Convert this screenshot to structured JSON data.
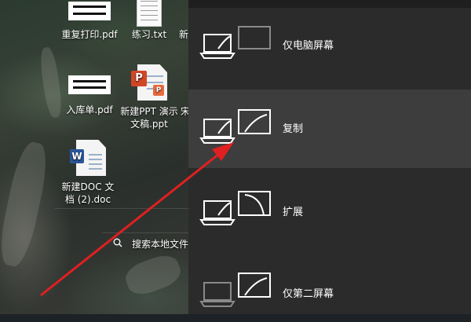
{
  "desktop": {
    "icons": [
      {
        "label": "重复打印.pdf",
        "kind": "pdf"
      },
      {
        "label": "练习.txt",
        "kind": "txt"
      },
      {
        "label": "入库单.pdf",
        "kind": "pdf"
      },
      {
        "label": "新建PPT 演示文稿.ppt",
        "kind": "ppt",
        "label_line1": "新建PPT 演示",
        "label_line2": "文稿.ppt"
      },
      {
        "label": "新建DOC 文档 (2).doc",
        "kind": "doc",
        "label_line1": "新建DOC 文",
        "label_line2": "档 (2).doc"
      }
    ],
    "partial_labels": [
      "新",
      "宋"
    ],
    "search": {
      "text": "搜索本地文件"
    }
  },
  "project_panel": {
    "options": [
      {
        "label": "仅电脑屏幕",
        "selected": false,
        "icon": "pc-screen-only-icon"
      },
      {
        "label": "复制",
        "selected": true,
        "icon": "duplicate-icon"
      },
      {
        "label": "扩展",
        "selected": false,
        "icon": "extend-icon"
      },
      {
        "label": "仅第二屏幕",
        "selected": false,
        "icon": "second-screen-only-icon"
      }
    ],
    "colors": {
      "background": "#2b2b2b",
      "selected": "#3d3d3d",
      "text": "#ffffff"
    }
  },
  "annotation": {
    "arrow_color": "#e02020"
  }
}
